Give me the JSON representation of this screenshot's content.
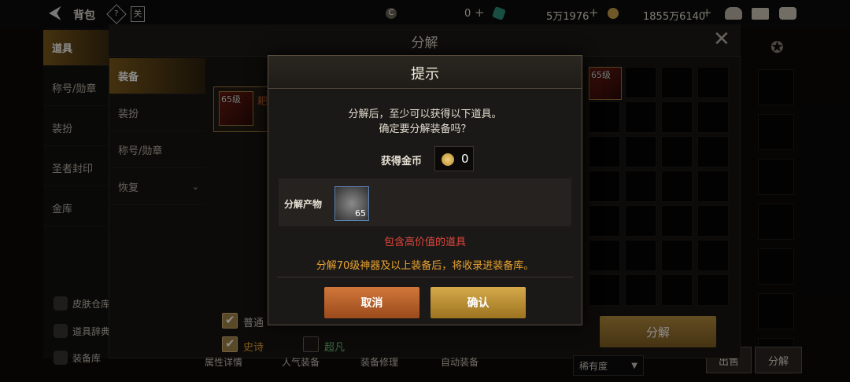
{
  "topbar": {
    "title": "背包",
    "currency1_value": "0",
    "currency2_value": "5万1976",
    "currency3_value": "1855万6140",
    "plus": "+"
  },
  "sidebar": {
    "items": [
      {
        "label": "道具"
      },
      {
        "label": "称号/勋章"
      },
      {
        "label": "装扮"
      },
      {
        "label": "圣者封印"
      },
      {
        "label": "金库"
      }
    ],
    "bottom": [
      {
        "label": "皮肤仓库"
      },
      {
        "label": "道具辞典"
      },
      {
        "label": "装备库"
      }
    ]
  },
  "panel": {
    "title": "分解",
    "tabs": [
      {
        "label": "装备"
      },
      {
        "label": "装扮"
      },
      {
        "label": "称号/勋章"
      },
      {
        "label": "恢复"
      }
    ],
    "item_level": "65级",
    "item_name_partial": "耙",
    "filters": [
      {
        "label": "普通",
        "checked": true
      },
      {
        "label": "史诗",
        "checked": true
      },
      {
        "label": "超凡",
        "checked": false
      }
    ],
    "toolbar": [
      "属性详情",
      "人气装备",
      "装备修理",
      "自动装备"
    ],
    "sort_label": "稀有度",
    "decompose_button": "分解"
  },
  "inventory": {
    "slot_level": "65级",
    "withdraw_button": "出售",
    "decompose_button": "分解"
  },
  "dialog": {
    "title": "提示",
    "line1": "分解后，至少可以获得以下道具。",
    "line2": "确定要分解装备吗？",
    "gold_label": "获得金币",
    "gold_value": "0",
    "yield_label": "分解产物",
    "yield_count": "65",
    "warning_red": "包含高价值的道具",
    "note_orange": "分解70级神器及以上装备后，将收录进装备库。",
    "cancel": "取消",
    "confirm": "确认"
  },
  "colors": {
    "gold_accent": "#b58c3e",
    "warning_red": "#e0463c",
    "note_orange": "#e8a230",
    "green_text": "#6fbf72"
  }
}
